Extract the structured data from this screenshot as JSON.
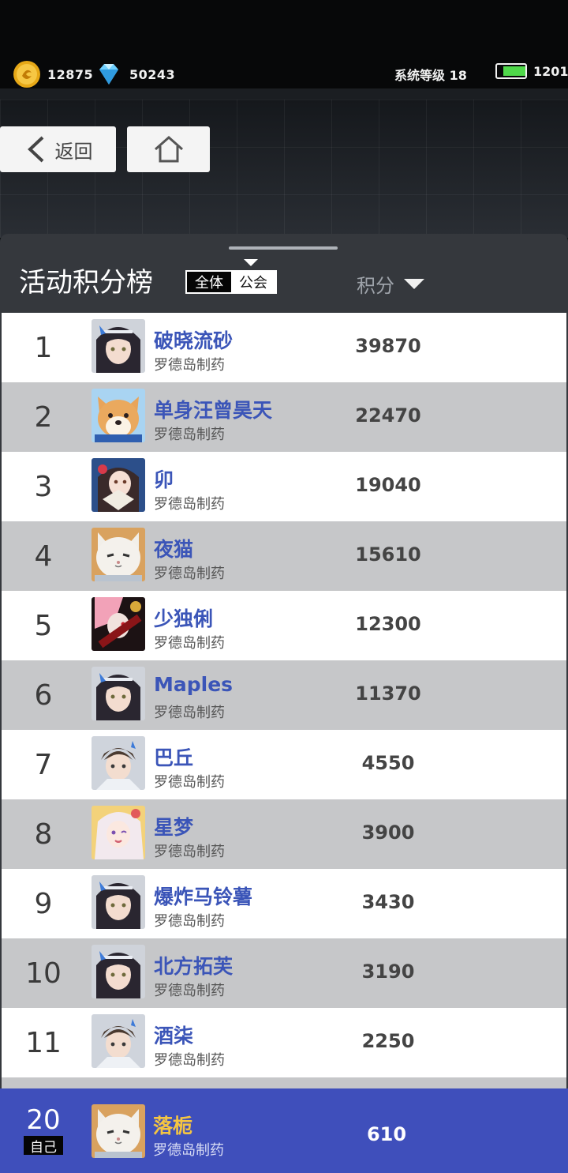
{
  "topbar": {
    "gold": "12875",
    "diamond": "50243",
    "system_level": "系统等级 18",
    "stamina": "1201"
  },
  "nav": {
    "back_label": "返回"
  },
  "board": {
    "title": "活动积分榜",
    "filter_all": "全体",
    "filter_guild": "公会",
    "score_header": "积分"
  },
  "players": [
    {
      "rank": "1",
      "name": "破晓流砂",
      "guild": "罗德岛制药",
      "score": "39870",
      "avatar": "girl-dark-hair-icon"
    },
    {
      "rank": "2",
      "name": "单身汪曾昊天",
      "guild": "罗德岛制药",
      "score": "22470",
      "avatar": "shiba-dog-icon"
    },
    {
      "rank": "3",
      "name": "卯",
      "guild": "罗德岛制药",
      "score": "19040",
      "avatar": "girl-fan-icon"
    },
    {
      "rank": "4",
      "name": "夜猫",
      "guild": "罗德岛制药",
      "score": "15610",
      "avatar": "white-cat-icon"
    },
    {
      "rank": "5",
      "name": "少独俐",
      "guild": "罗德岛制药",
      "score": "12300",
      "avatar": "pink-hair-icon"
    },
    {
      "rank": "6",
      "name": "Maples",
      "guild": "罗德岛制药",
      "score": "11370",
      "avatar": "girl-dark-hair-icon"
    },
    {
      "rank": "7",
      "name": "巴丘",
      "guild": "罗德岛制药",
      "score": "4550",
      "avatar": "boy-brown-hair-icon"
    },
    {
      "rank": "8",
      "name": "星梦",
      "guild": "罗德岛制药",
      "score": "3900",
      "avatar": "girl-white-hair-icon"
    },
    {
      "rank": "9",
      "name": "爆炸马铃薯",
      "guild": "罗德岛制药",
      "score": "3430",
      "avatar": "girl-dark-hair-icon"
    },
    {
      "rank": "10",
      "name": "北方拓芙",
      "guild": "罗德岛制药",
      "score": "3190",
      "avatar": "girl-dark-hair-icon"
    },
    {
      "rank": "11",
      "name": "酒柒",
      "guild": "罗德岛制药",
      "score": "2250",
      "avatar": "boy-brown-hair-icon"
    }
  ],
  "self": {
    "rank": "20",
    "tag": "自己",
    "name": "落栀",
    "guild": "罗德岛制药",
    "score": "610",
    "avatar": "white-cat-icon"
  },
  "colors": {
    "name_blue": "#3b55b8",
    "self_bar": "#3f4fbb",
    "self_name": "#f5c542"
  }
}
